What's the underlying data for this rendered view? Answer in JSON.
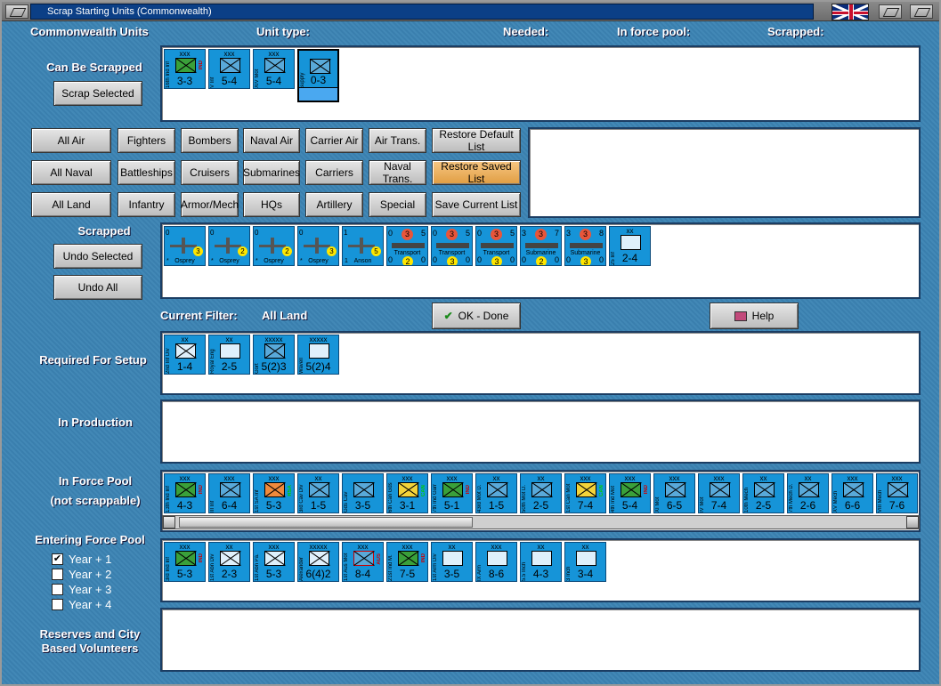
{
  "window": {
    "title": "Scrap Starting Units (Commonwealth)"
  },
  "header": {
    "country": "Commonwealth Units",
    "unit_type": "Unit type:",
    "needed": "Needed:",
    "in_force_pool": "In force pool:",
    "scrapped": "Scrapped:"
  },
  "can_be_scrapped": {
    "label": "Can Be Scrapped",
    "button": "Scrap Selected",
    "units": [
      {
        "size": "xxx",
        "name": "16th Ind Inf",
        "nat": "IND",
        "value": "3-3",
        "color": "green"
      },
      {
        "size": "xxx",
        "name": "V Inf",
        "nat": "",
        "value": "5-4",
        "color": "blue"
      },
      {
        "size": "xxx",
        "name": "XIV Mot",
        "nat": "",
        "value": "5-4",
        "color": "blue"
      },
      {
        "size": "",
        "name": "Supply",
        "nat": "",
        "value": "0-3",
        "color": "blue",
        "selected": true
      }
    ]
  },
  "filters": {
    "row1": [
      "All Air",
      "Fighters",
      "Bombers",
      "Naval Air",
      "Carrier Air",
      "Air Trans."
    ],
    "row2": [
      "All Naval",
      "Battleships",
      "Cruisers",
      "Submarines",
      "Carriers",
      "Naval Trans."
    ],
    "row3": [
      "All Land",
      "Infantry",
      "Armor/Mech",
      "HQs",
      "Artillery",
      "Special"
    ],
    "restore_default": "Restore Default List",
    "restore_saved": "Restore Saved List",
    "save_current": "Save Current List"
  },
  "scrapped": {
    "label": "Scrapped",
    "undo_selected": "Undo Selected",
    "undo_all": "Undo All",
    "air_units": [
      {
        "tl": "0",
        "name": "Osprey",
        "cnt": "3",
        "bl": "*"
      },
      {
        "tl": "0",
        "name": "Osprey",
        "cnt": "2",
        "bl": "*"
      },
      {
        "tl": "0",
        "name": "Osprey",
        "cnt": "2",
        "bl": "*"
      },
      {
        "tl": "0",
        "name": "Osprey",
        "cnt": "3",
        "bl": "*"
      },
      {
        "tl": "1",
        "name": "Anson",
        "cnt": "5",
        "bl": "1"
      }
    ],
    "ship_units": [
      {
        "tl": "0",
        "red": "3",
        "tr": "5",
        "name": "Transport",
        "yc": "2",
        "bl": "0",
        "br": "0"
      },
      {
        "tl": "0",
        "red": "3",
        "tr": "5",
        "name": "Transport",
        "yc": "3",
        "bl": "0",
        "br": "0"
      },
      {
        "tl": "0",
        "red": "3",
        "tr": "5",
        "name": "Transport",
        "yc": "3",
        "bl": "0",
        "br": "0"
      },
      {
        "tl": "3",
        "red": "3",
        "tr": "7",
        "name": "Submarine",
        "yc": "2",
        "bl": "0",
        "br": "0"
      },
      {
        "tl": "3",
        "red": "3",
        "tr": "8",
        "name": "Submarine",
        "yc": "3",
        "bl": "0",
        "br": "0"
      }
    ],
    "last_unit": {
      "size": "xx",
      "name": "25 Inf",
      "value": "2-4"
    }
  },
  "current_filter": {
    "label": "Current Filter:",
    "value": "All Land"
  },
  "ok_button": "OK - Done",
  "help_button": "Help",
  "required_for_setup": {
    "label": "Required For Setup",
    "units": [
      {
        "size": "xx",
        "name": "2nd Inf Div",
        "nat": "",
        "value": "1-4",
        "color": "plainx"
      },
      {
        "size": "xx",
        "name": "Royal Eng",
        "nat": "",
        "value": "2-5",
        "color": "plain"
      },
      {
        "size": "xxxxx",
        "name": "Gort",
        "nat": "",
        "value": "5(2)3",
        "color": "blue"
      },
      {
        "size": "xxxxx",
        "name": "Wavell",
        "nat": "",
        "value": "5(2)4",
        "color": "plain"
      }
    ]
  },
  "in_production": {
    "label": "In Production"
  },
  "in_force_pool": {
    "label1": "In Force Pool",
    "label2": "(not scrappable)",
    "units": [
      {
        "size": "xxx",
        "name": "13th Ind Inf",
        "nat": "IND",
        "value": "4-3",
        "color": "green"
      },
      {
        "size": "xxx",
        "name": "III Inf",
        "nat": "",
        "value": "6-4",
        "color": "blue"
      },
      {
        "size": "xxx",
        "name": "1st SA Inf",
        "nat": "RSA",
        "value": "5-3",
        "color": "orange"
      },
      {
        "size": "xx",
        "name": "3rd Cav Div",
        "nat": "",
        "value": "1-5",
        "color": "diag"
      },
      {
        "size": "",
        "name": "Gds Cav",
        "nat": "",
        "value": "3-5",
        "color": "diag"
      },
      {
        "size": "xxx",
        "name": "6th Can Gds",
        "nat": "CAN",
        "value": "3-1",
        "color": "yellow"
      },
      {
        "size": "xxx",
        "name": "7th Ind Garr",
        "nat": "IND",
        "value": "5-1",
        "color": "green"
      },
      {
        "size": "xx",
        "name": "43rd Mot D.",
        "nat": "",
        "value": "1-5",
        "color": "blue"
      },
      {
        "size": "xx",
        "name": "50th Mot D.",
        "nat": "",
        "value": "2-5",
        "color": "blue"
      },
      {
        "size": "xxx",
        "name": "1st Can Mot",
        "nat": "CAN",
        "value": "7-4",
        "color": "yellow"
      },
      {
        "size": "xxx",
        "name": "4th Ind Mot",
        "nat": "IND",
        "value": "5-4",
        "color": "green"
      },
      {
        "size": "xxx",
        "name": "XI Mot",
        "nat": "",
        "value": "6-5",
        "color": "blue"
      },
      {
        "size": "xxx",
        "name": "IV Mot",
        "nat": "",
        "value": "7-4",
        "color": "blue"
      },
      {
        "size": "xx",
        "name": "10th Mech",
        "nat": "",
        "value": "2-5",
        "color": "blue"
      },
      {
        "size": "xx",
        "name": "7th Mech D.",
        "nat": "",
        "value": "2-6",
        "color": "blue"
      },
      {
        "size": "xxx",
        "name": "XV Mech",
        "nat": "",
        "value": "6-6",
        "color": "blue"
      },
      {
        "size": "xxx",
        "name": "VIII Mech",
        "nat": "",
        "value": "7-6",
        "color": "blue"
      }
    ]
  },
  "entering_force_pool": {
    "label": "Entering Force Pool",
    "checkboxes": [
      {
        "label": "Year + 1",
        "checked": true
      },
      {
        "label": "Year + 2",
        "checked": false
      },
      {
        "label": "Year + 3",
        "checked": false
      },
      {
        "label": "Year + 4",
        "checked": false
      }
    ],
    "units": [
      {
        "size": "xxx",
        "name": "3rd Ind Inf",
        "nat": "IND",
        "value": "5-3",
        "color": "green"
      },
      {
        "size": "xx",
        "name": "1st Abn Div",
        "nat": "",
        "value": "2-3",
        "color": "plainx"
      },
      {
        "size": "xxx",
        "name": "1st Abn Pa.",
        "nat": "",
        "value": "5-3",
        "color": "plainx"
      },
      {
        "size": "xxxxx",
        "name": "Alexander",
        "nat": "",
        "value": "6(4)2",
        "color": "plainx"
      },
      {
        "size": "xxx",
        "name": "1st Aus Mot",
        "nat": "AUS",
        "value": "8-4",
        "color": "redx"
      },
      {
        "size": "xxx",
        "name": "21st Ind M.",
        "nat": "IND",
        "value": "7-5",
        "color": "green"
      },
      {
        "size": "xx",
        "name": "1st Arm Div",
        "nat": "",
        "value": "3-5",
        "color": "plain"
      },
      {
        "size": "xxx",
        "name": "IX Arm",
        "nat": "",
        "value": "8-6",
        "color": "plain"
      },
      {
        "size": "xx",
        "name": "5.5 Inch",
        "nat": "",
        "value": "4-3",
        "color": "plain"
      },
      {
        "size": "xx",
        "name": "3 Inch",
        "nat": "",
        "value": "3-4",
        "color": "plain"
      }
    ]
  },
  "reserves": {
    "label1": "Reserves and City",
    "label2": "Based Volunteers"
  }
}
